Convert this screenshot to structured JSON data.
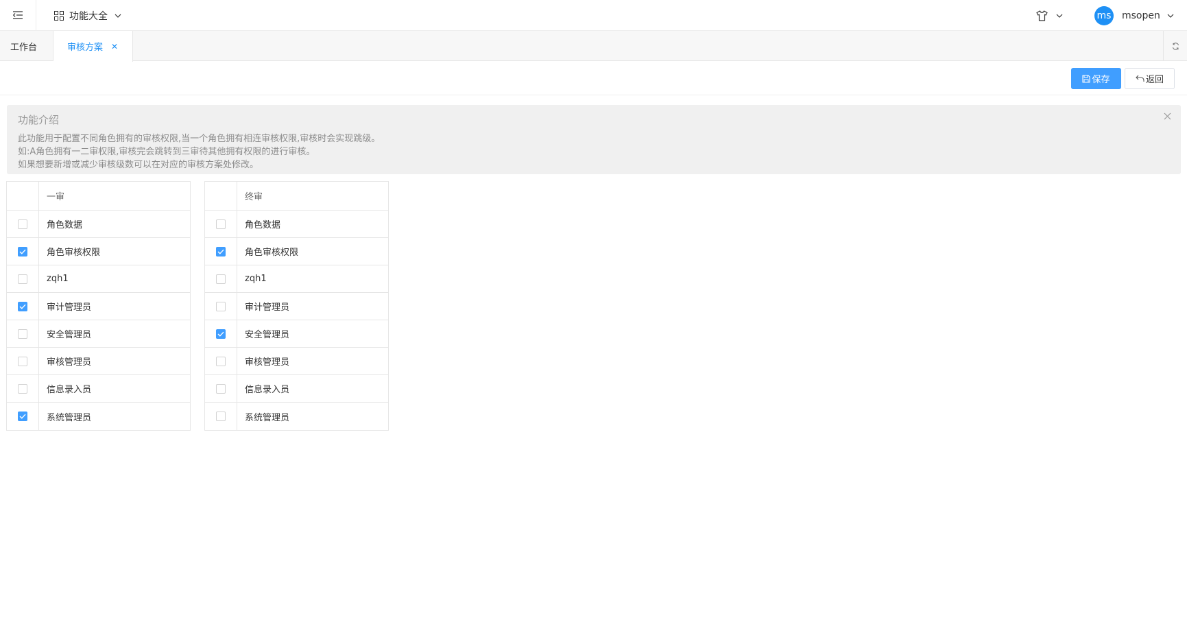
{
  "header": {
    "menu_label": "功能大全",
    "user": {
      "avatar_text": "ms",
      "name": "msopen"
    }
  },
  "tabs": [
    {
      "label": "工作台",
      "active": false
    },
    {
      "label": "审核方案",
      "active": true
    }
  ],
  "toolbar": {
    "save_label": "保存",
    "back_label": "返回"
  },
  "alert": {
    "title": "功能介绍",
    "lines": [
      "此功能用于配置不同角色拥有的审核权限,当一个角色拥有相连审核权限,审核时会实现跳级。",
      "如:A角色拥有一二审权限,审核完会跳转到三审待其他拥有权限的进行审核。",
      "如果想要新增或减少审核级数可以在对应的审核方案处修改。"
    ]
  },
  "tables": [
    {
      "header": "一审",
      "rows": [
        {
          "label": "角色数据",
          "checked": false
        },
        {
          "label": "角色审核权限",
          "checked": true
        },
        {
          "label": "zqh1",
          "checked": false
        },
        {
          "label": "审计管理员",
          "checked": true
        },
        {
          "label": "安全管理员",
          "checked": false
        },
        {
          "label": "审核管理员",
          "checked": false
        },
        {
          "label": "信息录入员",
          "checked": false
        },
        {
          "label": "系统管理员",
          "checked": true
        }
      ]
    },
    {
      "header": "终审",
      "rows": [
        {
          "label": "角色数据",
          "checked": false
        },
        {
          "label": "角色审核权限",
          "checked": true
        },
        {
          "label": "zqh1",
          "checked": false
        },
        {
          "label": "审计管理员",
          "checked": false
        },
        {
          "label": "安全管理员",
          "checked": true
        },
        {
          "label": "审核管理员",
          "checked": false
        },
        {
          "label": "信息录入员",
          "checked": false
        },
        {
          "label": "系统管理员",
          "checked": false
        }
      ]
    }
  ],
  "colors": {
    "primary": "#409eff",
    "avatar": "#1e90f5",
    "alert_bg": "#f0f0f0"
  },
  "icons": [
    "menu-fold-icon",
    "apps-grid-icon",
    "chevron-down-icon",
    "shirt-icon",
    "refresh-icon",
    "save-icon",
    "back-icon",
    "close-icon",
    "check-icon"
  ]
}
